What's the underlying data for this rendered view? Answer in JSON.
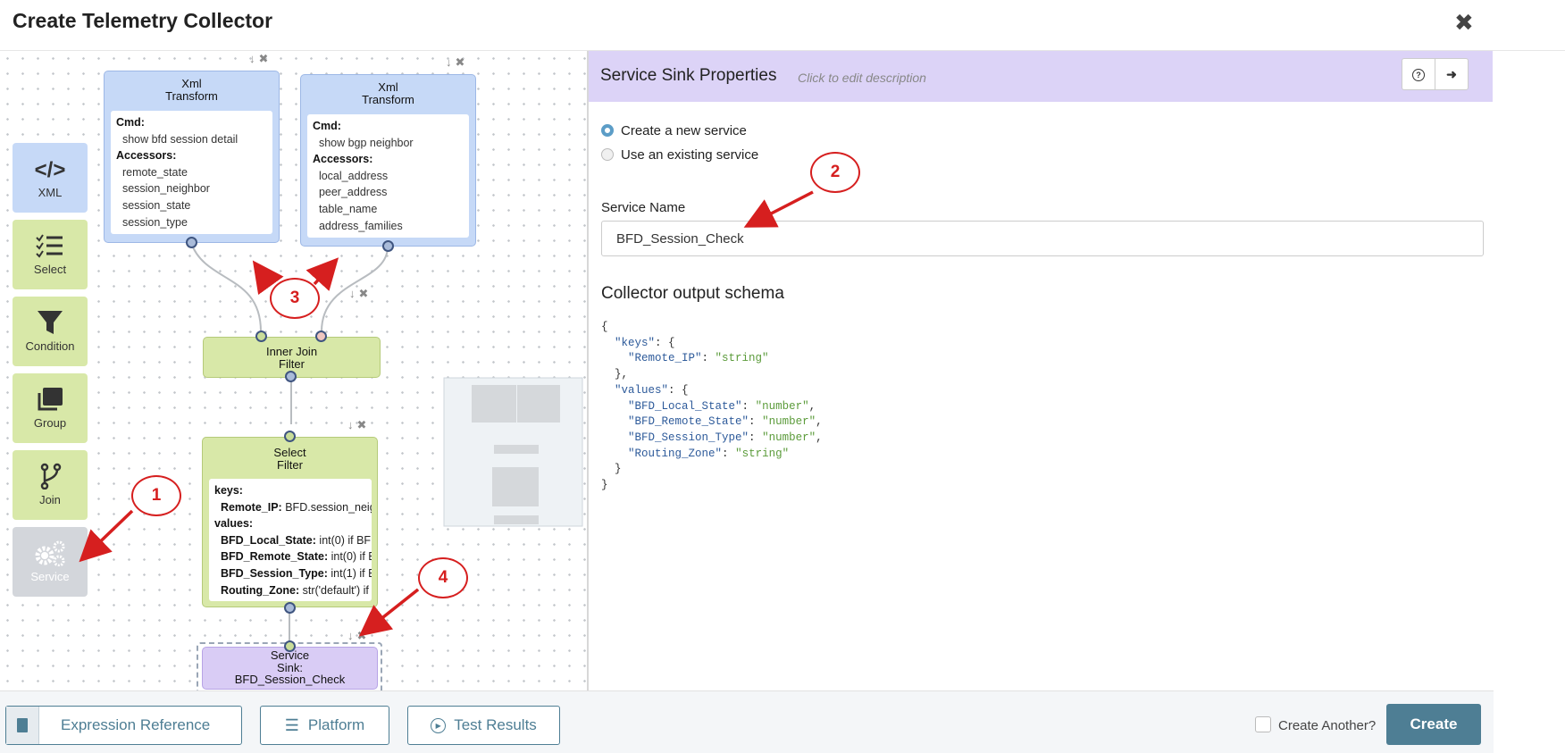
{
  "dialog": {
    "title": "Create Telemetry Collector",
    "close_glyph": "✖"
  },
  "palette": [
    {
      "label": "XML",
      "icon": "code-icon"
    },
    {
      "label": "Select",
      "icon": "checklist-icon"
    },
    {
      "label": "Condition",
      "icon": "filter-icon"
    },
    {
      "label": "Group",
      "icon": "layers-icon"
    },
    {
      "label": "Join",
      "icon": "branch-icon"
    },
    {
      "label": "Service",
      "icon": "gears-icon"
    }
  ],
  "nodes": {
    "xml1": {
      "title1": "Xml",
      "title2": "Transform",
      "cmd_label": "Cmd:",
      "cmd": "show bfd session detail",
      "acc_label": "Accessors:",
      "accessors": [
        "remote_state",
        "session_neighbor",
        "session_state",
        "session_type"
      ]
    },
    "xml2": {
      "title1": "Xml",
      "title2": "Transform",
      "cmd_label": "Cmd:",
      "cmd": "show bgp neighbor",
      "acc_label": "Accessors:",
      "accessors": [
        "local_address",
        "peer_address",
        "table_name",
        "address_families"
      ]
    },
    "join": {
      "title1": "Inner Join",
      "title2": "Filter"
    },
    "select": {
      "title1": "Select",
      "title2": "Filter",
      "keys_label": "keys:",
      "key_rows": [
        {
          "name": "Remote_IP:",
          "expr": "BFD.session_neig"
        }
      ],
      "values_label": "values:",
      "value_rows": [
        {
          "name": "BFD_Local_State:",
          "expr": "int(0) if BFD"
        },
        {
          "name": "BFD_Remote_State:",
          "expr": "int(0) if B"
        },
        {
          "name": "BFD_Session_Type:",
          "expr": "int(1) if Bl"
        },
        {
          "name": "Routing_Zone:",
          "expr": "str('default') if"
        }
      ]
    },
    "sink": {
      "line1": "Service",
      "line2": "Sink:",
      "line3": "BFD_Session_Check"
    }
  },
  "properties": {
    "title": "Service Sink Properties",
    "description_placeholder": "Click to edit description",
    "help_glyph": "?",
    "exit_glyph": "➜",
    "radio_new": "Create a new service",
    "radio_existing": "Use an existing service",
    "selected_radio": "new",
    "service_name_label": "Service Name",
    "service_name_value": "BFD_Session_Check",
    "schema_title": "Collector output schema"
  },
  "footer": {
    "expression_reference": "Expression Reference",
    "platform": "Platform",
    "test_results": "Test Results",
    "create_another": "Create Another?",
    "create": "Create"
  },
  "annotations": [
    "1",
    "2",
    "3",
    "4"
  ],
  "colors": {
    "accent": "#4e7e94",
    "callout": "#d61f1f",
    "xml_node": "#c6d9f7",
    "filter_node": "#d8e8a8",
    "sink_node": "#d9ccf5"
  }
}
